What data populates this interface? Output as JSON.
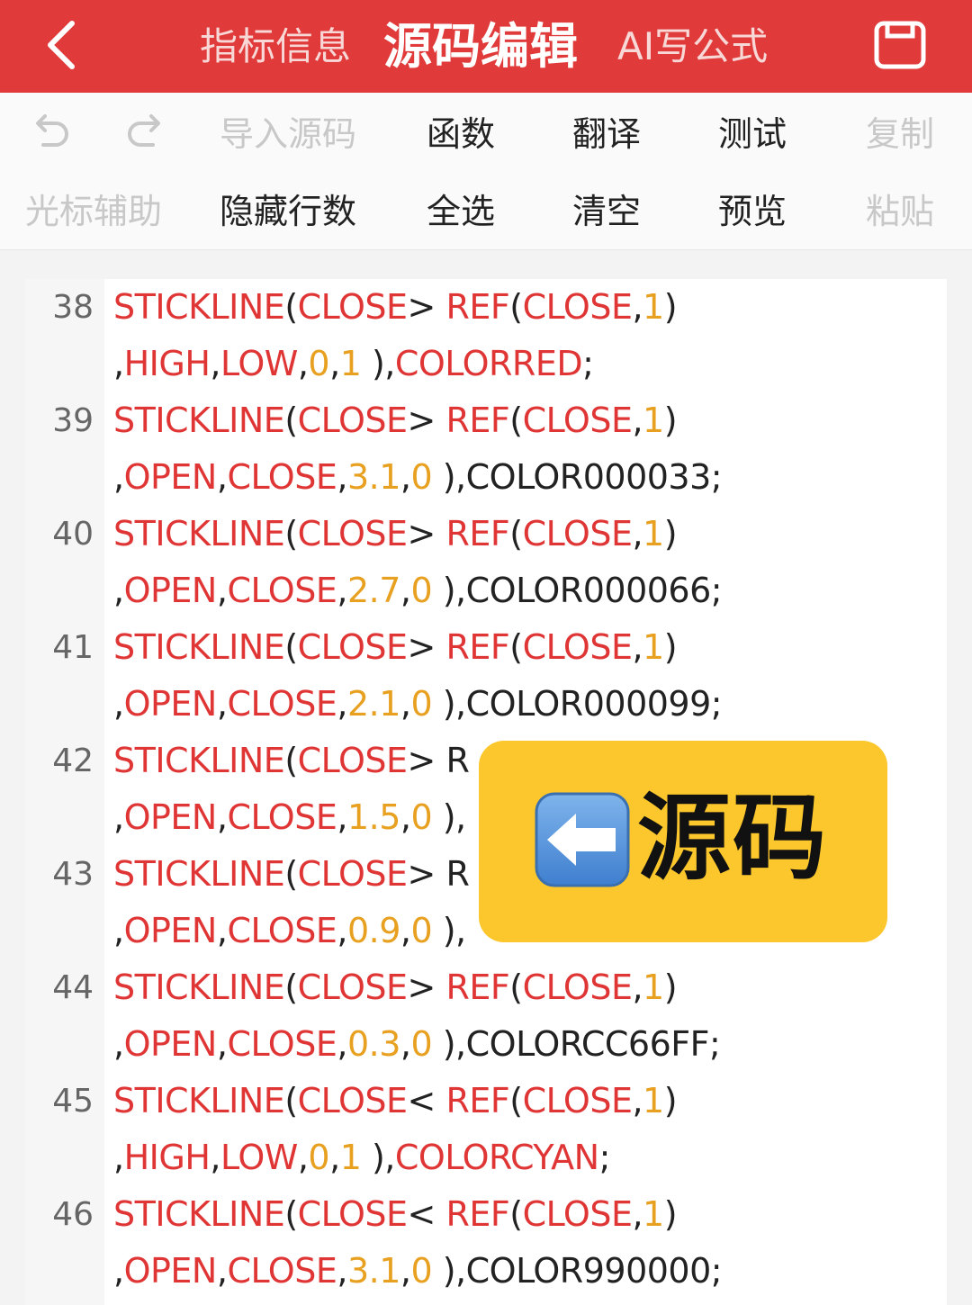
{
  "header": {
    "tab_info": "指标信息",
    "tab_source": "源码编辑",
    "tab_ai": "AI写公式"
  },
  "toolbar": {
    "import": "导入源码",
    "functions": "函数",
    "translate": "翻译",
    "test": "测试",
    "copy": "复制",
    "cursor_assist": "光标辅助",
    "hide_lines": "隐藏行数",
    "select_all": "全选",
    "clear": "清空",
    "preview": "预览",
    "paste": "粘贴"
  },
  "editor": {
    "line_numbers": [
      "38",
      "39",
      "40",
      "41",
      "42",
      "43",
      "44",
      "45",
      "46"
    ],
    "cond_gt": "STICKLINE(CLOSE> REF(CLOSE,1)",
    "cond_lt": "STICKLINE(CLOSE< REF(CLOSE,1)",
    "cond_gt_cut": "STICKLINE(CLOSE> R",
    "l38b": ",HIGH,LOW,0,1 ),COLORRED;",
    "l39b": ",OPEN,CLOSE,3.1,0 ),COLOR000033;",
    "l40b": ",OPEN,CLOSE,2.7,0 ),COLOR000066;",
    "l41b": ",OPEN,CLOSE,2.1,0 ),COLOR000099;",
    "l42b": ",OPEN,CLOSE,1.5,0 ),",
    "l43b": ",OPEN,CLOSE,0.9,0 ),",
    "l44b": ",OPEN,CLOSE,0.3,0 ),COLORCC66FF;",
    "l45b": ",HIGH,LOW,0,1 ),COLORCYAN;",
    "l46b": ",OPEN,CLOSE,3.1,0 ),COLOR990000;"
  },
  "overlay": {
    "label": "源码",
    "arrow_icon": "left-arrow-icon"
  },
  "colors": {
    "header_red": "#e03a3a",
    "keyword_red": "#e03535",
    "number_orange": "#e8a020",
    "badge_yellow": "#fcc72c"
  }
}
